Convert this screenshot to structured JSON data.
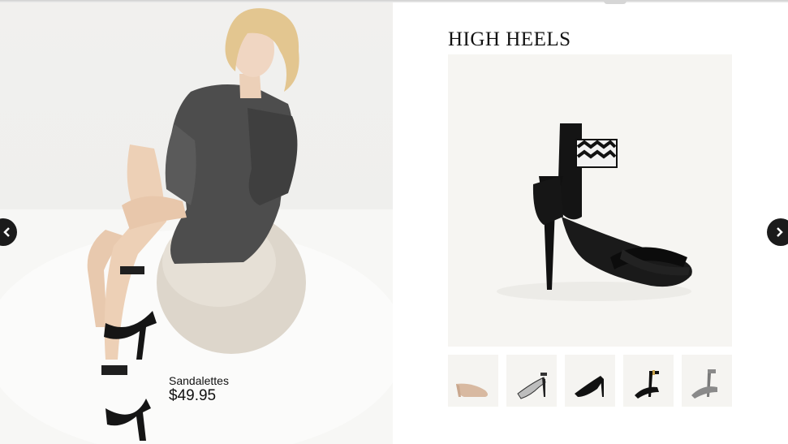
{
  "lookbook": {
    "product_name": "Sandalettes",
    "product_price": "$49.95"
  },
  "category": {
    "title": "HIGH HEELS"
  },
  "thumbnails": [
    {
      "icon": "nude-pump-icon"
    },
    {
      "icon": "snakeskin-heel-icon"
    },
    {
      "icon": "black-pump-icon"
    },
    {
      "icon": "black-strap-sandal-icon"
    },
    {
      "icon": "grey-strap-sandal-icon"
    }
  ],
  "navigation": {
    "prev_icon": "chevron-left-icon",
    "next_icon": "chevron-right-icon"
  }
}
